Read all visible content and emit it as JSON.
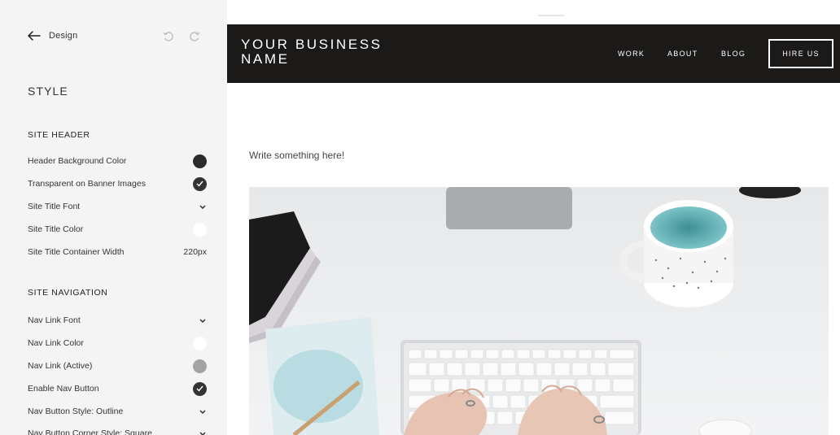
{
  "sidebar": {
    "back_label": "Design",
    "style_title": "STYLE",
    "site_header": {
      "heading": "SITE HEADER",
      "items": [
        {
          "label": "Header Background Color",
          "control": "swatch",
          "color": "#2b2b2b"
        },
        {
          "label": "Transparent on Banner Images",
          "control": "checkbox",
          "checked": true
        },
        {
          "label": "Site Title Font",
          "control": "dropdown"
        },
        {
          "label": "Site Title Color",
          "control": "swatch",
          "color": "#ffffff"
        },
        {
          "label": "Site Title Container Width",
          "control": "value",
          "value": "220px"
        }
      ]
    },
    "site_navigation": {
      "heading": "SITE NAVIGATION",
      "items": [
        {
          "label": "Nav Link Font",
          "control": "dropdown"
        },
        {
          "label": "Nav Link Color",
          "control": "swatch",
          "color": "#ffffff"
        },
        {
          "label": "Nav Link (Active)",
          "control": "swatch",
          "color": "#a3a3a3"
        },
        {
          "label": "Enable Nav Button",
          "control": "checkbox",
          "checked": true
        },
        {
          "label": "Nav Button Style: Outline",
          "control": "dropdown"
        },
        {
          "label": "Nav Button Corner Style: Square",
          "control": "dropdown"
        }
      ]
    }
  },
  "preview": {
    "site_title": "YOUR BUSINESS NAME",
    "nav": [
      "WORK",
      "ABOUT",
      "BLOG"
    ],
    "nav_button": "HIRE US",
    "body_text": "Write something here!",
    "header_color": "#1c1a18"
  }
}
